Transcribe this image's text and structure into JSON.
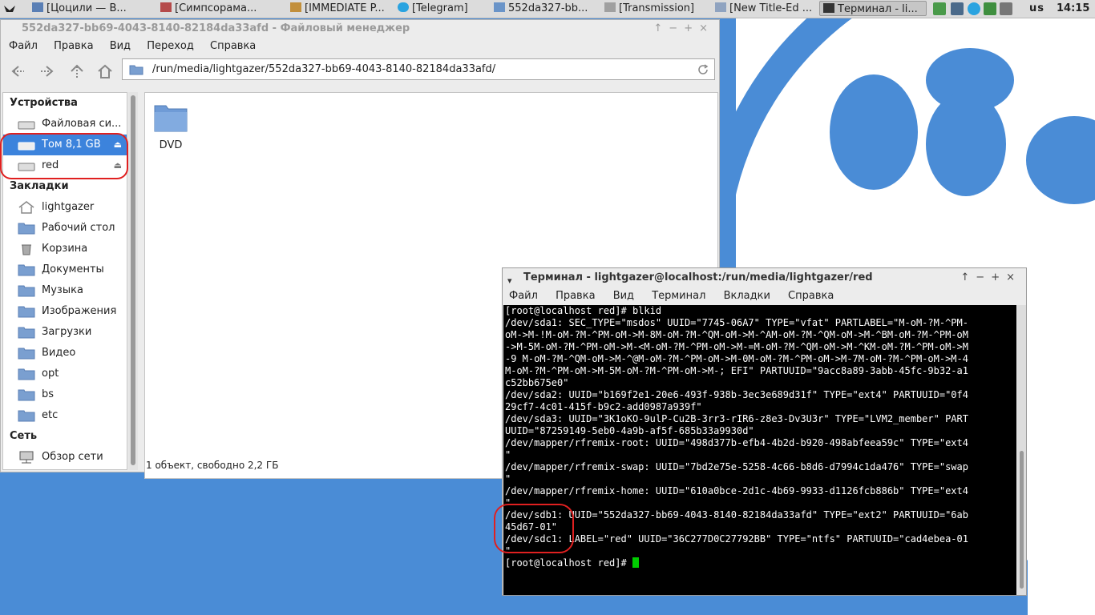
{
  "taskbar": {
    "tasks": [
      {
        "label": "[Цоцили — В..."
      },
      {
        "label": "[Симпсорама..."
      },
      {
        "label": "[IMMEDIATE P..."
      },
      {
        "label": "[Telegram]"
      },
      {
        "label": "552da327-bb..."
      },
      {
        "label": "[Transmission]"
      },
      {
        "label": "[New Title-Ed ..."
      },
      {
        "label": "Терминал - li..."
      }
    ],
    "keyboard_layout": "us",
    "clock": "14:15"
  },
  "file_manager": {
    "title": "552da327-bb69-4043-8140-82184da33afd - Файловый менеджер",
    "menu": [
      "Файл",
      "Правка",
      "Вид",
      "Переход",
      "Справка"
    ],
    "path": "/run/media/lightgazer/552da327-bb69-4043-8140-82184da33afd/",
    "sidebar": {
      "devices_header": "Устройства",
      "devices": [
        {
          "label": "Файловая си..."
        },
        {
          "label": "Том 8,1 GB"
        },
        {
          "label": "red"
        }
      ],
      "bookmarks_header": "Закладки",
      "bookmarks": [
        {
          "label": "lightgazer"
        },
        {
          "label": "Рабочий стол"
        },
        {
          "label": "Корзина"
        },
        {
          "label": "Документы"
        },
        {
          "label": "Музыка"
        },
        {
          "label": "Изображения"
        },
        {
          "label": "Загрузки"
        },
        {
          "label": "Видео"
        },
        {
          "label": "opt"
        },
        {
          "label": "bs"
        },
        {
          "label": "etc"
        }
      ],
      "network_header": "Сеть",
      "network": [
        {
          "label": "Обзор сети"
        }
      ]
    },
    "items": [
      {
        "name": "DVD"
      }
    ],
    "status": "1 объект, свободно 2,2 ГБ"
  },
  "terminal": {
    "title": "Терминал - lightgazer@localhost:/run/media/lightgazer/red",
    "menu": [
      "Файл",
      "Правка",
      "Вид",
      "Терминал",
      "Вкладки",
      "Справка"
    ],
    "lines": [
      "[root@localhost red]# blkid",
      "/dev/sda1: SEC_TYPE=\"msdos\" UUID=\"7745-06A7\" TYPE=\"vfat\" PARTLABEL=\"M-oM-?M-^PM-",
      "oM->M-!M-oM-?M-^PM-oM->M-8M-oM-?M-^QM-oM->M-^AM-oM-?M-^QM-oM->M-^BM-oM-?M-^PM-oM",
      "->M-5M-oM-?M-^PM-oM->M-<M-oM-?M-^PM-oM->M-=M-oM-?M-^QM-oM->M-^KM-oM-?M-^PM-oM->M",
      "-9 M-oM-?M-^QM-oM->M-^@M-oM-?M-^PM-oM->M-0M-oM-?M-^PM-oM->M-7M-oM-?M-^PM-oM->M-4",
      "M-oM-?M-^PM-oM->M-5M-oM-?M-^PM-oM->M-; EFI\" PARTUUID=\"9acc8a89-3abb-45fc-9b32-a1",
      "c52bb675e0\"",
      "/dev/sda2: UUID=\"b169f2e1-20e6-493f-938b-3ec3e689d31f\" TYPE=\"ext4\" PARTUUID=\"0f4",
      "29cf7-4c01-415f-b9c2-add0987a939f\"",
      "/dev/sda3: UUID=\"3K1oKO-9ulP-Cu2B-3rr3-rIR6-z8e3-Dv3U3r\" TYPE=\"LVM2_member\" PART",
      "UUID=\"87259149-5eb0-4a9b-af5f-685b33a9930d\"",
      "/dev/mapper/rfremix-root: UUID=\"498d377b-efb4-4b2d-b920-498abfeea59c\" TYPE=\"ext4",
      "\"",
      "/dev/mapper/rfremix-swap: UUID=\"7bd2e75e-5258-4c66-b8d6-d7994c1da476\" TYPE=\"swap",
      "\"",
      "/dev/mapper/rfremix-home: UUID=\"610a0bce-2d1c-4b69-9933-d1126fcb886b\" TYPE=\"ext4",
      "\"",
      "/dev/sdb1: UUID=\"552da327-bb69-4043-8140-82184da33afd\" TYPE=\"ext2\" PARTUUID=\"6ab",
      "45d67-01\"",
      "/dev/sdc1: LABEL=\"red\" UUID=\"36C277D0C27792BB\" TYPE=\"ntfs\" PARTUUID=\"cad4ebea-01",
      "\""
    ],
    "prompt": "[root@localhost red]# "
  },
  "colors": {
    "wallpaper": "#4a8cd6",
    "selection": "#3c83dc",
    "annotation": "#e02020",
    "cursor": "#00cc00"
  }
}
